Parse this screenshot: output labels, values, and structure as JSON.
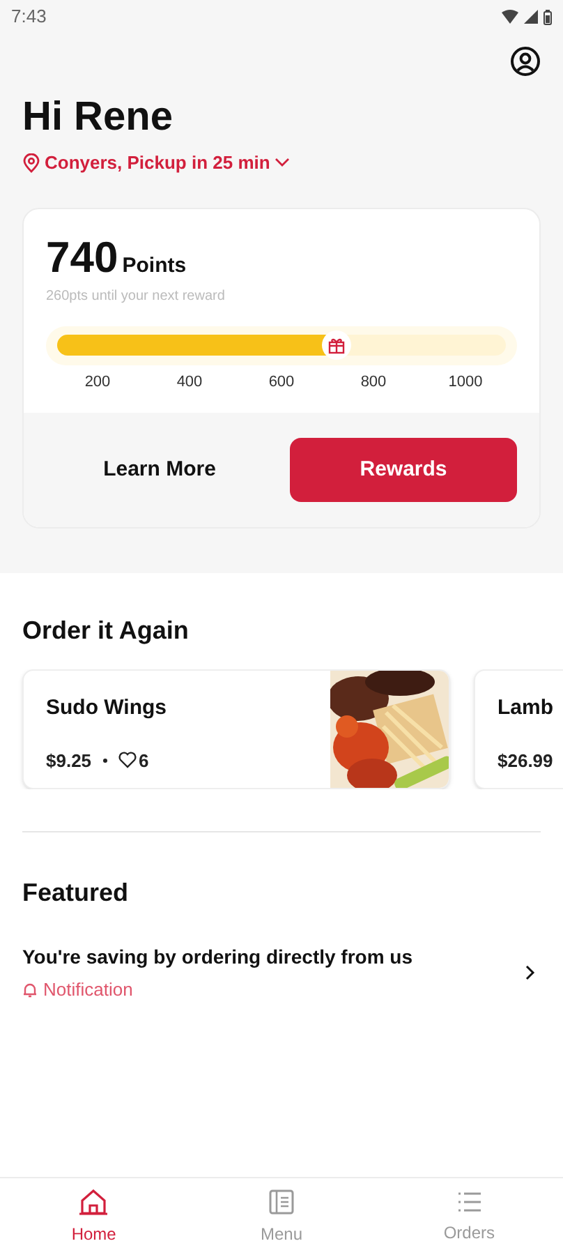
{
  "status_bar": {
    "time": "7:43"
  },
  "greeting": "Hi Rene",
  "location": "Conyers, Pickup in 25 min",
  "rewards": {
    "points": "740",
    "points_label": "Points",
    "subtitle": "260pts until your next reward",
    "level": 0.62,
    "ticks": [
      "200",
      "400",
      "600",
      "800",
      "1000"
    ],
    "buttons": [
      "Learn More",
      "Rewards"
    ]
  },
  "order_again": {
    "title": "Order it Again",
    "items": [
      {
        "name": "Sudo Wings",
        "price": "$9.25",
        "likes": "6",
        "kind": "picture"
      },
      {
        "name": "Lamb",
        "price": "$26.99"
      }
    ]
  },
  "featured": {
    "title": "Featured",
    "items": [
      {
        "title": "You're saving by ordering directly from us",
        "tag": "Notification"
      }
    ]
  },
  "nav": [
    {
      "label": "Home",
      "selected": true,
      "kind": "home"
    },
    {
      "label": "Menu",
      "selected": false,
      "kind": "menu"
    },
    {
      "label": "Orders",
      "selected": false,
      "kind": "orders"
    }
  ]
}
